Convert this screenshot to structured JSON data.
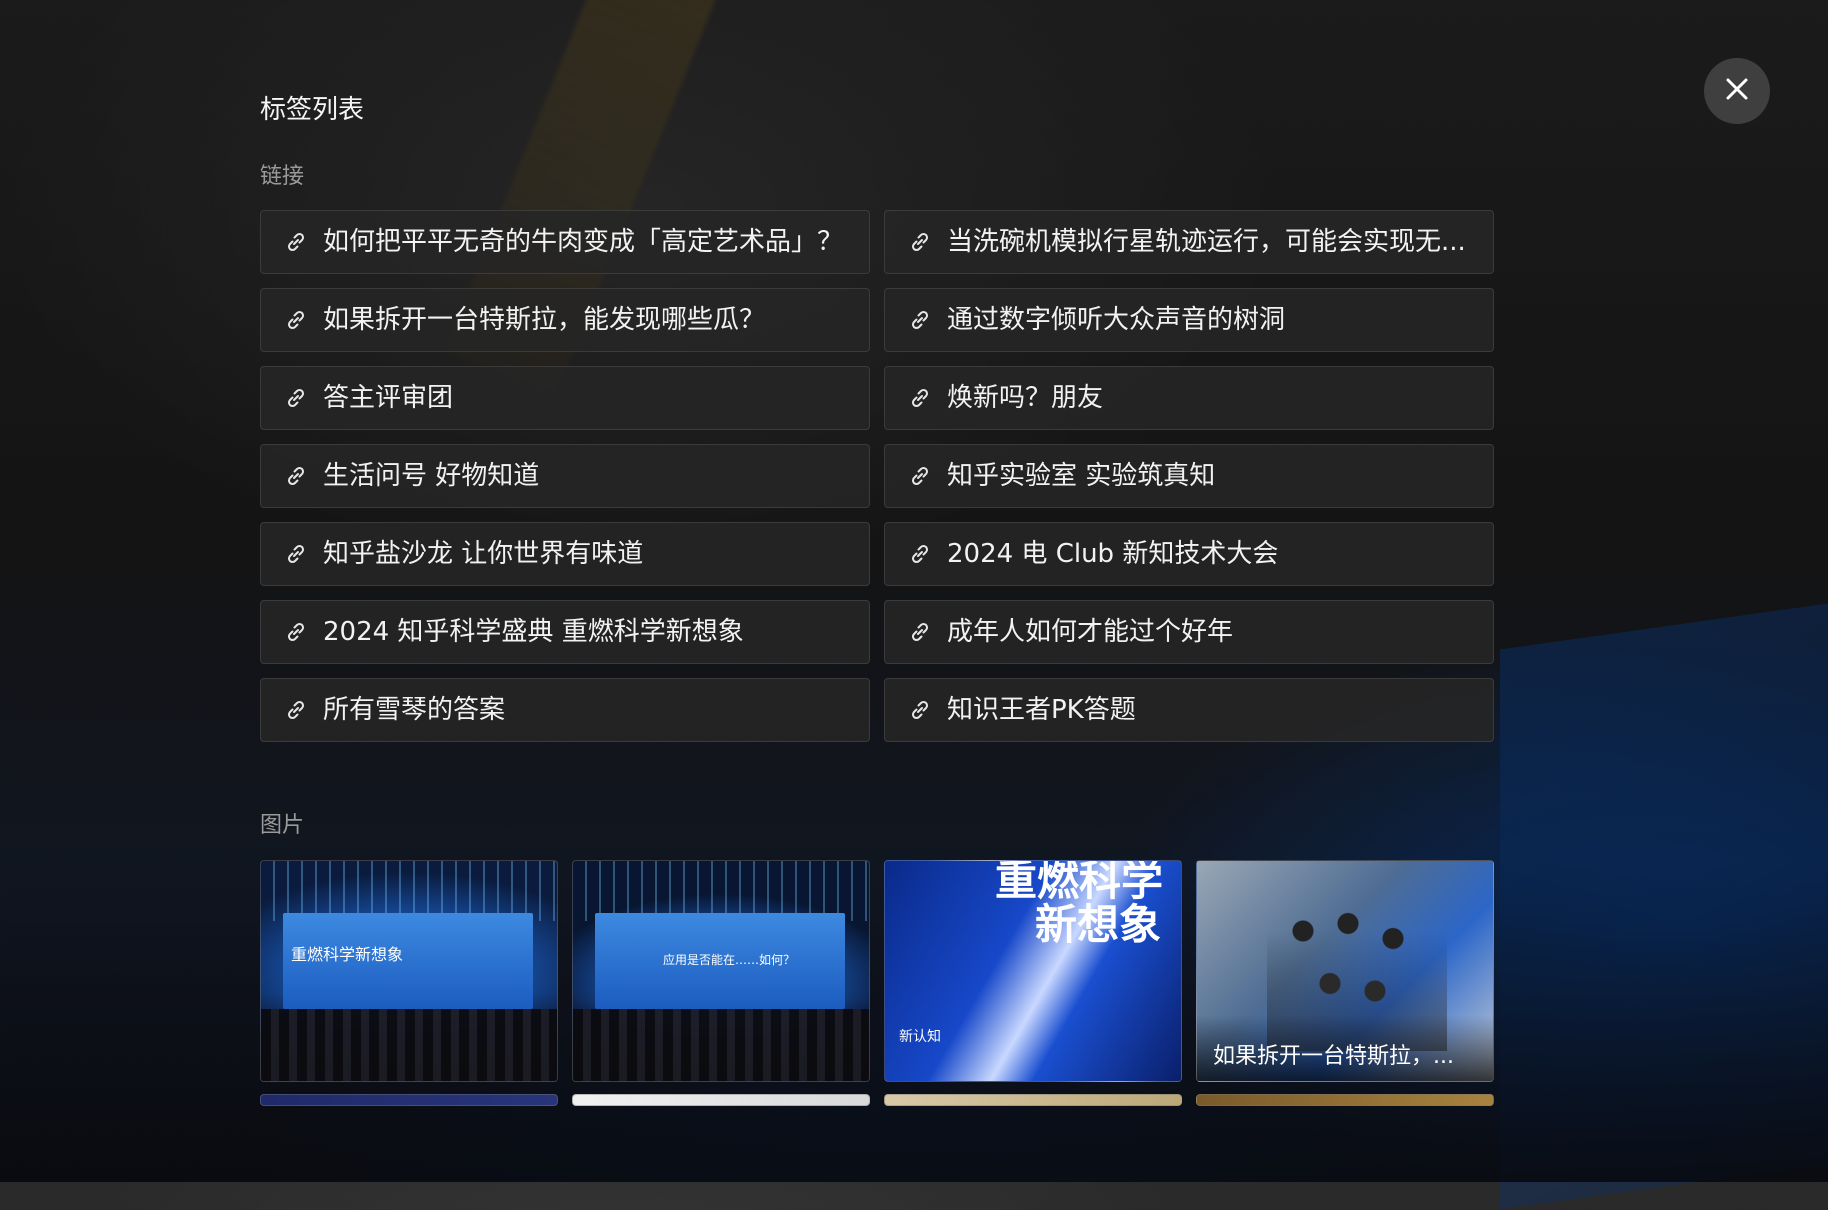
{
  "panel": {
    "title": "标签列表"
  },
  "sections": {
    "links_label": "链接",
    "images_label": "图片"
  },
  "links": [
    "如何把平平无奇的牛肉变成「高定艺术品」？",
    "当洗碗机模拟行星轨迹运行，可能会实现无...",
    "如果拆开一台特斯拉，能发现哪些瓜？",
    "通过数字倾听大众声音的树洞",
    "答主评审团",
    "焕新吗？朋友",
    "生活问号 好物知道",
    "知乎实验室 实验筑真知",
    "知乎盐沙龙 让你世界有味道",
    "2024 电 Club 新知技术大会",
    "2024 知乎科学盛典 重燃科学新想象",
    "成年人如何才能过个好年",
    "所有雪琴的答案",
    "知识王者PK答题"
  ],
  "images": {
    "thumb1_text": "重燃科学新想象",
    "thumb2_text": "应用是否能在……如何？",
    "thumb3_line1": "重燃科学",
    "thumb3_line2": "新想象",
    "thumb3_small": "新认知",
    "thumb4_caption": "如果拆开一台特斯拉，..."
  },
  "icons": {
    "close": "close-icon",
    "link": "link-icon"
  },
  "colors": {
    "link_bg": "#262626",
    "text": "#f2f2f2",
    "label": "#9a9a9a"
  }
}
